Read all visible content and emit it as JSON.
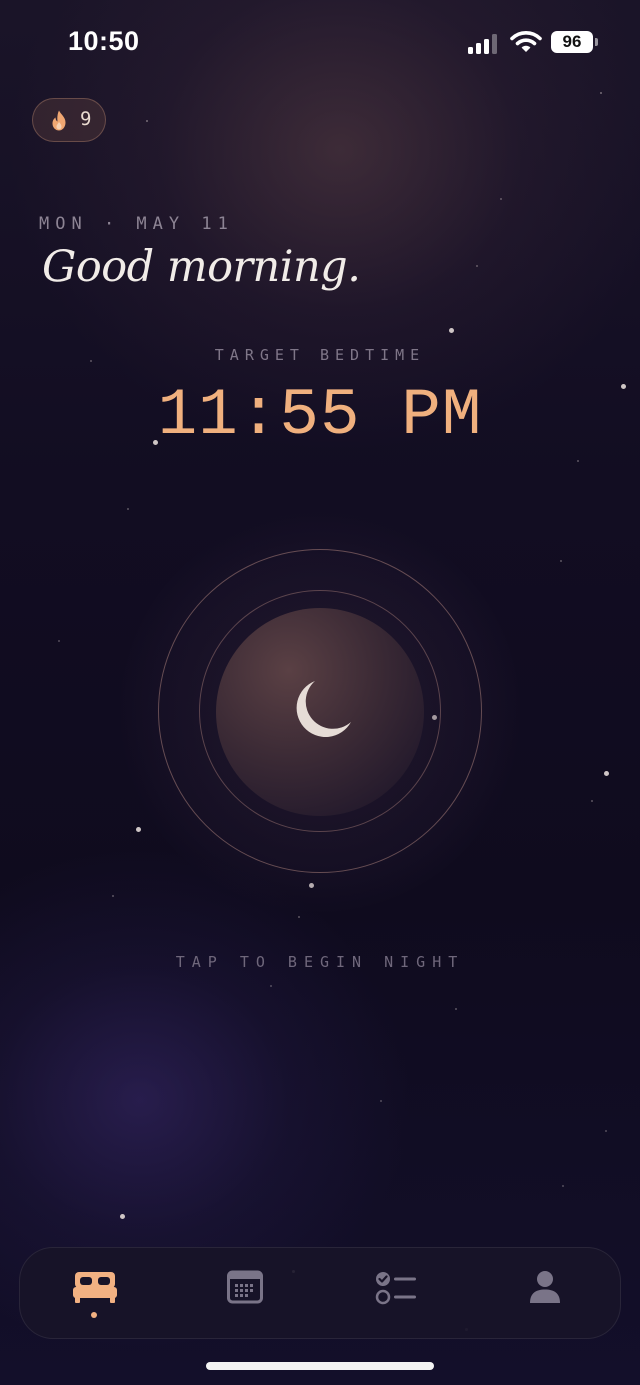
{
  "status_bar": {
    "time": "10:50",
    "battery": "96"
  },
  "streak": {
    "count": "9",
    "icon": "flame-icon"
  },
  "header": {
    "date": "MON · MAY 11",
    "greeting": "Good morning."
  },
  "bedtime": {
    "label": "TARGET BEDTIME",
    "time": "11:55 PM"
  },
  "night_button": {
    "icon": "moon-icon",
    "hint": "TAP TO BEGIN NIGHT"
  },
  "tab_bar": {
    "tabs": [
      {
        "name": "sleep",
        "icon": "bed-icon",
        "active": true
      },
      {
        "name": "calendar",
        "icon": "calendar-icon",
        "active": false
      },
      {
        "name": "checklist",
        "icon": "checklist-icon",
        "active": false
      },
      {
        "name": "profile",
        "icon": "profile-icon",
        "active": false
      }
    ]
  },
  "colors": {
    "accent": "#f0b07e",
    "background": "#100c22",
    "text": "#f1ece8"
  }
}
